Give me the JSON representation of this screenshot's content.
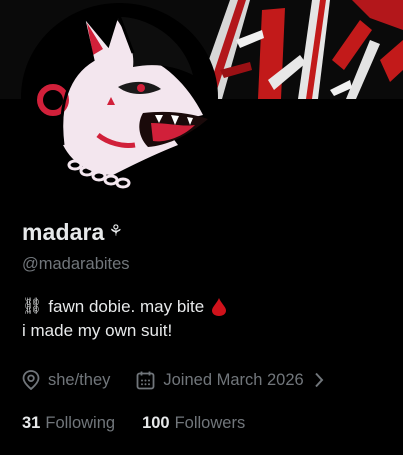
{
  "profile": {
    "display_name": "madara",
    "name_emoji": "⚘",
    "handle": "@madarabites",
    "bio": {
      "line1_emoji": "⛓",
      "line1_text": "fawn dobie. may bite",
      "line1_trailing_icon": "blood-drop-icon",
      "line2_text": "i made my own suit!"
    },
    "pronouns": "she/they",
    "joined": "Joined March 2026",
    "following_count": "31",
    "following_label": "Following",
    "followers_count": "100",
    "followers_label": "Followers"
  },
  "colors": {
    "background": "#000000",
    "primary_text": "#e7e9ea",
    "secondary_text": "#71767b",
    "blood_red": "#d0121b",
    "banner_red": "#c21a1a"
  },
  "icons": {
    "location": "location-pin-icon",
    "calendar": "calendar-icon",
    "more": "chevron-right-icon"
  }
}
